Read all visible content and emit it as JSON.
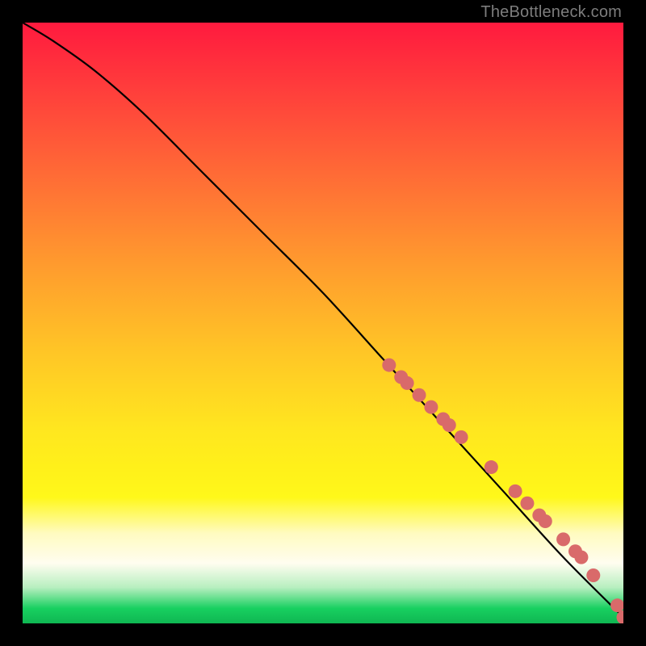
{
  "watermark": "TheBottleneck.com",
  "chart_data": {
    "type": "line",
    "title": "",
    "xlabel": "",
    "ylabel": "",
    "xlim": [
      0,
      100
    ],
    "ylim": [
      0,
      100
    ],
    "grid": false,
    "series": [
      {
        "name": "curve",
        "kind": "line",
        "x": [
          0,
          5,
          12,
          20,
          30,
          40,
          50,
          60,
          70,
          80,
          90,
          100
        ],
        "y": [
          100,
          97,
          92,
          85,
          75,
          65,
          55,
          44,
          33,
          22,
          11,
          1
        ]
      },
      {
        "name": "points",
        "kind": "scatter",
        "x": [
          61,
          63,
          64,
          66,
          68,
          70,
          71,
          73,
          78,
          82,
          84,
          86,
          87,
          90,
          92,
          93,
          95,
          99,
          100
        ],
        "y": [
          43,
          41,
          40,
          38,
          36,
          34,
          33,
          31,
          26,
          22,
          20,
          18,
          17,
          14,
          12,
          11,
          8,
          3,
          1
        ]
      }
    ],
    "colors": {
      "curve": "#000000",
      "points": "#d96a6a"
    }
  }
}
